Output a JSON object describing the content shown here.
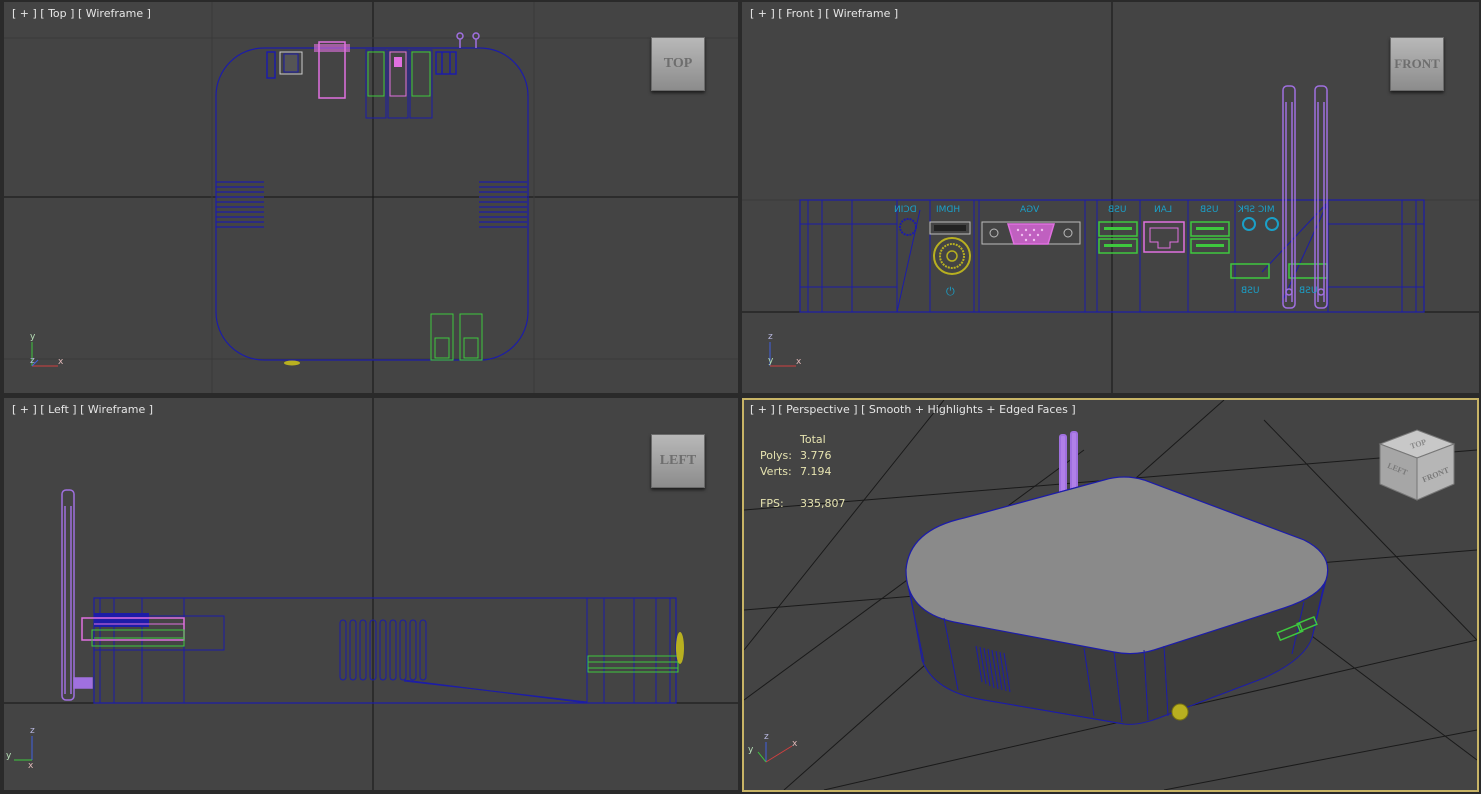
{
  "viewports": {
    "top": {
      "plus": "[ + ]",
      "view": "[ Top ]",
      "shading": "[ Wireframe ]",
      "cube": "TOP"
    },
    "front": {
      "plus": "[ + ]",
      "view": "[ Front ]",
      "shading": "[ Wireframe ]",
      "cube": "FRONT"
    },
    "left": {
      "plus": "[ + ]",
      "view": "[ Left ]",
      "shading": "[ Wireframe ]",
      "cube": "LEFT"
    },
    "persp": {
      "plus": "[ + ]",
      "view": "[ Perspective ]",
      "shading": "[ Smooth + Highlights + Edged Faces ]",
      "cube_faces": {
        "top": "TOP",
        "left": "LEFT",
        "front": "FRONT"
      }
    }
  },
  "stats": {
    "header": "Total",
    "polys_label": "Polys:",
    "polys": "3.776",
    "verts_label": "Verts:",
    "verts": "7.194",
    "fps_label": "FPS:",
    "fps": "335,807"
  },
  "port_labels": {
    "dcin": "DCIN",
    "hdmi": "HDMI",
    "vga": "VGA",
    "usb1": "USB",
    "lan": "LAN",
    "usb2": "USB",
    "mic_spk": "MIC SPK",
    "usb3": "USB",
    "usb4": "USB"
  },
  "axes": {
    "x": "x",
    "y": "y",
    "z": "z"
  },
  "colors": {
    "viewport_bg": "#444444",
    "wire_blue": "#1c1ca8",
    "wire_pink": "#e070e0",
    "wire_green": "#3ec83e",
    "wire_purple": "#a070e0",
    "wire_yellow": "#b8b020",
    "port_cyan": "#1aa0c8",
    "active_border": "#c8b466",
    "grid_dark": "#111111"
  }
}
